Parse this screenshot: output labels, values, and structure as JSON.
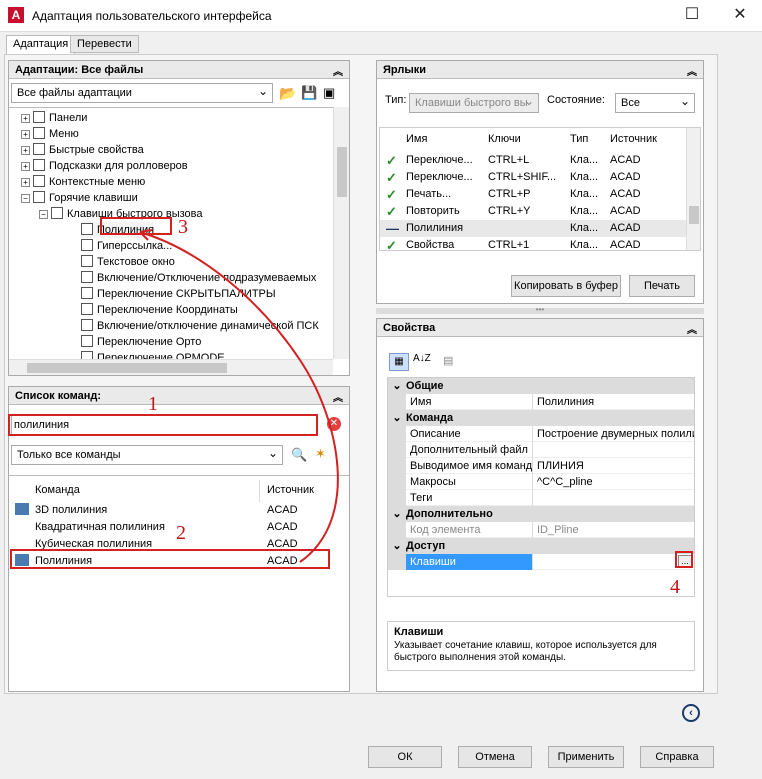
{
  "window": {
    "title": "Адаптация пользовательского интерфейса",
    "logo": "A",
    "maximize": "☐",
    "close": "✕"
  },
  "tabs": [
    "Адаптация",
    "Перевести"
  ],
  "customize_panel": {
    "title": "Адаптации: Все файлы",
    "filter": "Все файлы адаптации",
    "tree": [
      {
        "label": "Панели",
        "indent": 1
      },
      {
        "label": "Меню",
        "indent": 1
      },
      {
        "label": "Быстрые свойства",
        "indent": 1
      },
      {
        "label": "Подсказки для ролловеров",
        "indent": 1
      },
      {
        "label": "Контекстные меню",
        "indent": 1
      },
      {
        "label": "Горячие клавиши",
        "indent": 1
      },
      {
        "label": "Клавиши быстрого вызова",
        "indent": 2
      },
      {
        "label": "Полилиния",
        "indent": 3
      },
      {
        "label": "Гиперссылка...",
        "indent": 3
      },
      {
        "label": "Текстовое окно",
        "indent": 3
      },
      {
        "label": "Включение/Отключение подразумеваемых",
        "indent": 3
      },
      {
        "label": "Переключение СКРЫТЬПАЛИТРЫ",
        "indent": 3
      },
      {
        "label": "Переключение Координаты",
        "indent": 3
      },
      {
        "label": "Включение/отключение динамической ПСК",
        "indent": 3
      },
      {
        "label": "Переключение Орто",
        "indent": 3
      },
      {
        "label": "Переключение ОРМОDE",
        "indent": 3
      }
    ]
  },
  "commands_panel": {
    "title": "Список команд:",
    "search_value": "полилиния",
    "filter": "Только все команды",
    "col_command": "Команда",
    "col_source": "Источник",
    "rows": [
      {
        "name": "3D полилиния",
        "source": "ACAD"
      },
      {
        "name": "Квадратичная полилиния",
        "source": "ACAD"
      },
      {
        "name": "Кубическая полилиния",
        "source": "ACAD"
      },
      {
        "name": "Полилиния",
        "source": "ACAD"
      }
    ]
  },
  "shortcuts_panel": {
    "title": "Ярлыки",
    "type_label": "Тип:",
    "type_value": "Клавиши быстрого вы",
    "state_label": "Состояние:",
    "state_value": "Все",
    "headers": [
      "Имя",
      "Ключи",
      "Тип",
      "Источник"
    ],
    "rows": [
      {
        "name": "Переключе...",
        "keys": "CTRL+L",
        "type": "Кла...",
        "source": "ACAD",
        "mark": "✓"
      },
      {
        "name": "Переключе...",
        "keys": "CTRL+SHIF...",
        "type": "Кла...",
        "source": "ACAD",
        "mark": "✓"
      },
      {
        "name": "Печать...",
        "keys": "CTRL+P",
        "type": "Кла...",
        "source": "ACAD",
        "mark": "✓"
      },
      {
        "name": "Повторить",
        "keys": "CTRL+Y",
        "type": "Кла...",
        "source": "ACAD",
        "mark": "✓"
      },
      {
        "name": "Полилиния",
        "keys": "",
        "type": "Кла...",
        "source": "ACAD",
        "mark": "—"
      },
      {
        "name": "Свойства",
        "keys": "CTRL+1",
        "type": "Кла...",
        "source": "ACAD",
        "mark": "✓"
      }
    ],
    "copy_button": "Копировать в буфер",
    "print_button": "Печать"
  },
  "properties_panel": {
    "title": "Свойства",
    "sections": [
      {
        "title": "Общие",
        "rows": [
          {
            "name": "Имя",
            "value": "Полилиния"
          }
        ]
      },
      {
        "title": "Команда",
        "rows": [
          {
            "name": "Описание",
            "value": "Построение двумерных полили"
          },
          {
            "name": "Дополнительный файл",
            "value": ""
          },
          {
            "name": "Выводимое имя команд",
            "value": "ПЛИНИЯ"
          },
          {
            "name": "Макросы",
            "value": "^C^C_pline"
          },
          {
            "name": "Теги",
            "value": ""
          }
        ]
      },
      {
        "title": "Дополнительно",
        "rows": [
          {
            "name": "Код элемента",
            "value": "ID_Pline"
          }
        ]
      },
      {
        "title": "Доступ",
        "rows": [
          {
            "name": "Клавиши",
            "value": ""
          }
        ]
      }
    ],
    "ellipsis": "...",
    "help_title": "Клавиши",
    "help_text": "Указывает сочетание клавиш, которое используется для быстрого выполнения этой команды."
  },
  "annotations": [
    "1",
    "2",
    "3",
    "4"
  ],
  "footer": {
    "ok": "ОК",
    "cancel": "Отмена",
    "apply": "Применить",
    "help": "Справка"
  },
  "colors": {
    "annotation": "#d32020",
    "selection": "#3399ff"
  }
}
